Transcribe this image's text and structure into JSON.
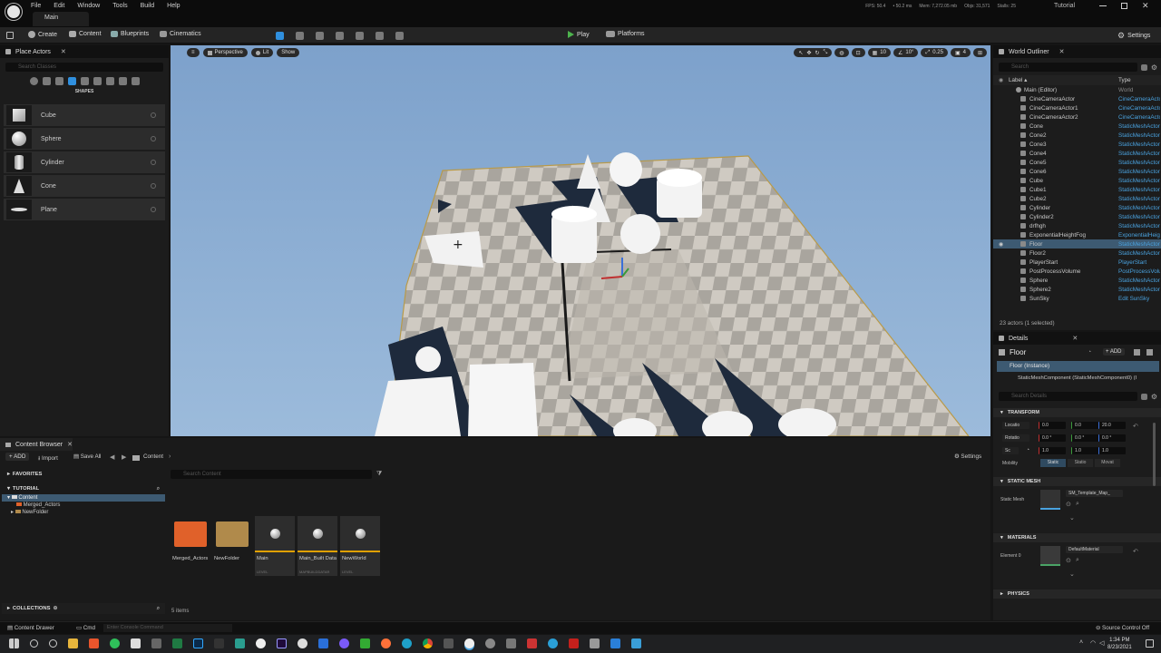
{
  "app": {
    "level_tab": "Main",
    "tutorial": "Tutorial"
  },
  "menu": [
    "File",
    "Edit",
    "Window",
    "Tools",
    "Build",
    "Help"
  ],
  "stats": [
    "FPS: 50.4",
    "• 50.2 ms",
    "Mem: 7,272.05 mb",
    "Objs: 31,571",
    "Stalls: 25"
  ],
  "toolbar": {
    "create": "Create",
    "content": "Content",
    "blueprints": "Blueprints",
    "cinematics": "Cinematics",
    "play": "Play",
    "platforms": "Platforms",
    "settings": "Settings"
  },
  "place_actors": {
    "title": "Place Actors",
    "search_placeholder": "Search Classes",
    "category": "SHAPES",
    "items": [
      "Cube",
      "Sphere",
      "Cylinder",
      "Cone",
      "Plane"
    ]
  },
  "viewport": {
    "perspective": "Perspective",
    "lit": "Lit",
    "show": "Show",
    "grid_snap": "10",
    "rot_snap": "10°",
    "scale_snap": "0.25",
    "cam_speed": "4"
  },
  "outliner": {
    "title": "World Outliner",
    "search_placeholder": "Search",
    "col_label": "Label ▴",
    "col_type": "Type",
    "root": {
      "label": "Main (Editor)",
      "type": "World"
    },
    "rows": [
      {
        "label": "CineCameraActor",
        "type": "CineCameraActor"
      },
      {
        "label": "CineCameraActor1",
        "type": "CineCameraActor"
      },
      {
        "label": "CineCameraActor2",
        "type": "CineCameraActor"
      },
      {
        "label": "Cone",
        "type": "StaticMeshActor"
      },
      {
        "label": "Cone2",
        "type": "StaticMeshActor"
      },
      {
        "label": "Cone3",
        "type": "StaticMeshActor"
      },
      {
        "label": "Cone4",
        "type": "StaticMeshActor"
      },
      {
        "label": "Cone5",
        "type": "StaticMeshActor"
      },
      {
        "label": "Cone6",
        "type": "StaticMeshActor"
      },
      {
        "label": "Cube",
        "type": "StaticMeshActor"
      },
      {
        "label": "Cube1",
        "type": "StaticMeshActor"
      },
      {
        "label": "Cube2",
        "type": "StaticMeshActor"
      },
      {
        "label": "Cylinder",
        "type": "StaticMeshActor"
      },
      {
        "label": "Cylinder2",
        "type": "StaticMeshActor"
      },
      {
        "label": "drfhgh",
        "type": "StaticMeshActor"
      },
      {
        "label": "ExponentialHeightFog",
        "type": "ExponentialHeightFog"
      },
      {
        "label": "Floor",
        "type": "StaticMeshActor"
      },
      {
        "label": "Floor2",
        "type": "StaticMeshActor"
      },
      {
        "label": "PlayerStart",
        "type": "PlayerStart"
      },
      {
        "label": "PostProcessVolume",
        "type": "PostProcessVolume"
      },
      {
        "label": "Sphere",
        "type": "StaticMeshActor"
      },
      {
        "label": "Sphere2",
        "type": "StaticMeshActor"
      },
      {
        "label": "SunSky",
        "type": "Edit SunSky"
      }
    ],
    "selected_index": 16,
    "summary": "23 actors (1 selected)"
  },
  "details": {
    "title": "Details",
    "actor": "Floor",
    "add": "ADD",
    "instance": "Floor (Instance)",
    "component": "StaticMeshComponent (StaticMeshComponent0) (I",
    "search_placeholder": "Search Details",
    "transform": "TRANSFORM",
    "location_label": "Locatio",
    "rotation_label": "Rotatio",
    "scale_label": "Sc",
    "location": [
      "0.0",
      "0.0",
      "20.0"
    ],
    "rotation": [
      "0.0 °",
      "0.0 °",
      "0.0 °"
    ],
    "scale": [
      "1.0",
      "1.0",
      "1.0"
    ],
    "mobility_label": "Mobility",
    "mobility": [
      "Static",
      "Statio",
      "Movat"
    ],
    "static_mesh_section": "STATIC MESH",
    "static_mesh_label": "Static Mesh",
    "static_mesh_value": "SM_Template_Map_",
    "materials_section": "MATERIALS",
    "element_label": "Element 0",
    "material_value": "DefaultMaterial",
    "physics_section": "PHYSICS"
  },
  "content_browser": {
    "title": "Content Browser",
    "add": "ADD",
    "import": "Import",
    "save_all": "Save All",
    "path": "Content",
    "settings": "Settings",
    "favorites": "FAVORITES",
    "tutorial": "TUTORIAL",
    "tree": [
      "Content",
      "Merged_Actors",
      "NewFolder"
    ],
    "collections": "COLLECTIONS",
    "search_placeholder": "Search Content",
    "items_count": "5 items",
    "assets": [
      {
        "name": "Merged_Actors",
        "type": ""
      },
      {
        "name": "NewFolder",
        "type": ""
      },
      {
        "name": "Main",
        "type": "LEVEL"
      },
      {
        "name": "Main_Built Data",
        "type": "MAPBUILDDATAR"
      },
      {
        "name": "NewWorld",
        "type": "LEVEL"
      }
    ]
  },
  "status": {
    "content_drawer": "Content Drawer",
    "cmd": "Cmd",
    "console_placeholder": "Enter Console Command",
    "source_control": "Source Control Off"
  },
  "clock": {
    "time": "1:34 PM",
    "date": "8/23/2021"
  },
  "colors": {
    "accent": "#2f8fde",
    "play": "#4db34d",
    "selection": "#3d5a72",
    "folder_orange": "#e0612a",
    "folder_tan": "#b08a4b"
  }
}
